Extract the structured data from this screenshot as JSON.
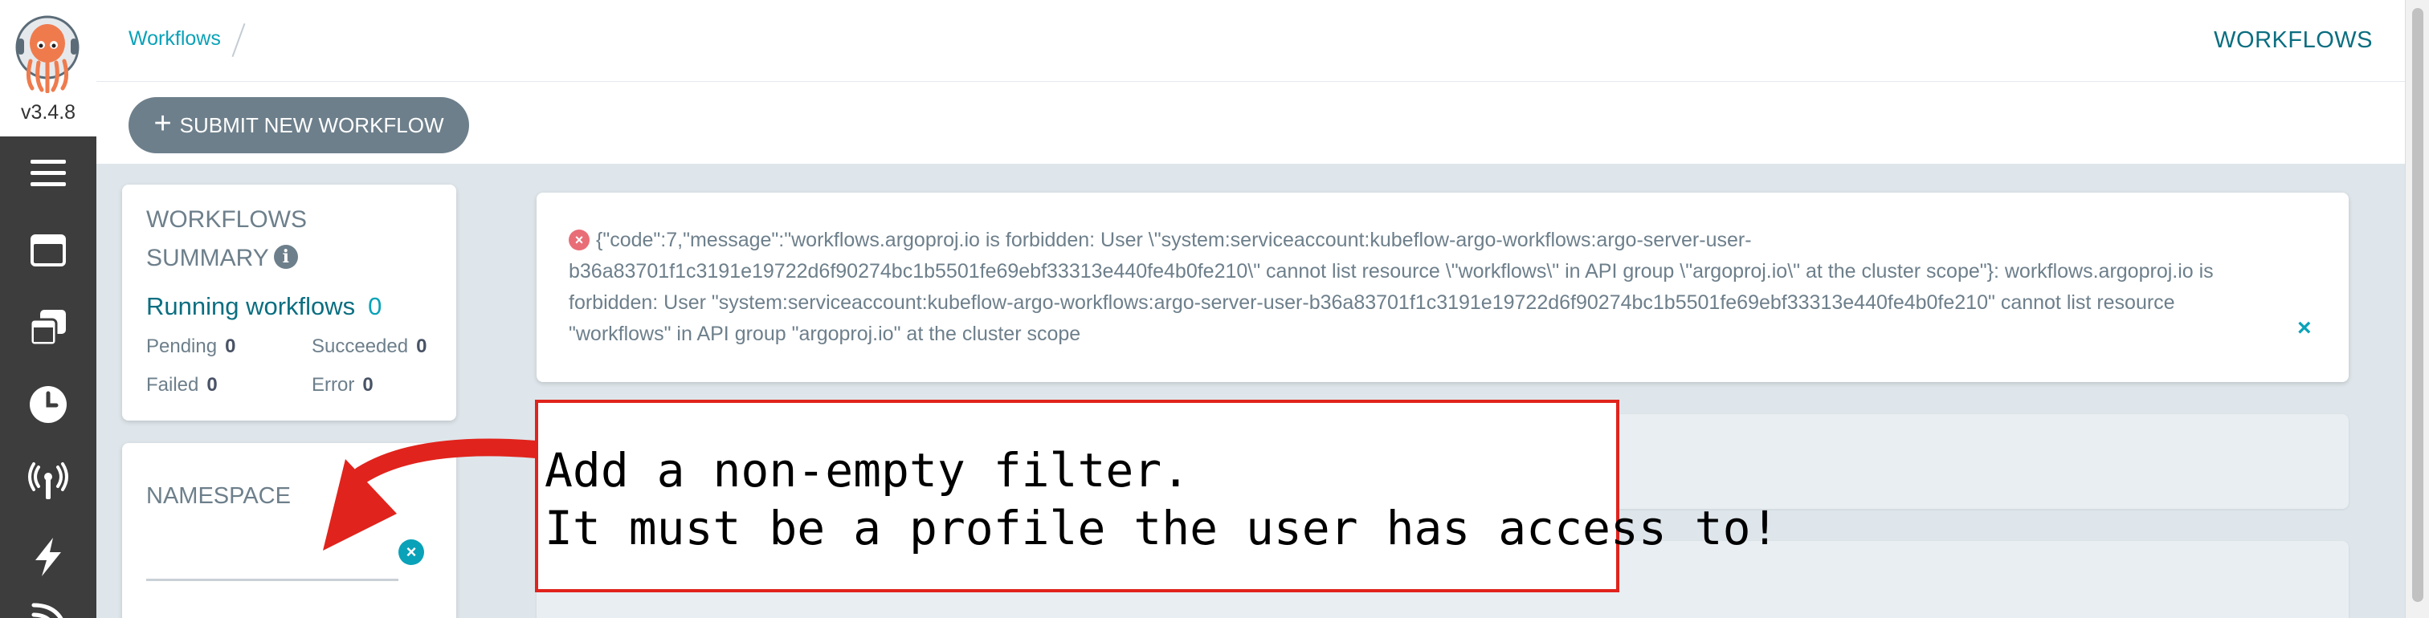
{
  "app": {
    "version": "v3.4.8"
  },
  "nav": {
    "items": [
      {
        "icon": "menu-icon"
      },
      {
        "icon": "workflows-icon"
      },
      {
        "icon": "workflow-templates-icon"
      },
      {
        "icon": "cron-workflows-icon"
      },
      {
        "icon": "event-sources-icon"
      },
      {
        "icon": "sensors-icon"
      },
      {
        "icon": "event-flow-icon"
      }
    ]
  },
  "header": {
    "breadcrumb": "Workflows",
    "title": "WORKFLOWS"
  },
  "toolbar": {
    "submit_label": "SUBMIT NEW WORKFLOW"
  },
  "summary": {
    "title": "WORKFLOWS SUMMARY",
    "running_label": "Running workflows",
    "running_count": "0",
    "pending_label": "Pending",
    "pending_count": "0",
    "succeeded_label": "Succeeded",
    "succeeded_count": "0",
    "failed_label": "Failed",
    "failed_count": "0",
    "error_label": "Error",
    "error_count": "0"
  },
  "namespace": {
    "label": "NAMESPACE",
    "value": ""
  },
  "error": {
    "message": "{\"code\":7,\"message\":\"workflows.argoproj.io is forbidden: User \\\"system:serviceaccount:kubeflow-argo-workflows:argo-server-user-b36a83701f1c3191e19722d6f90274bc1b5501fe69ebf33313e440fe4b0fe210\\\" cannot list resource \\\"workflows\\\" in API group \\\"argoproj.io\\\" at the cluster scope\"}: workflows.argoproj.io is forbidden: User \"system:serviceaccount:kubeflow-argo-workflows:argo-server-user-b36a83701f1c3191e19722d6f90274bc1b5501fe69ebf33313e440fe4b0fe210\" cannot list resource \"workflows\" in API group \"argoproj.io\" at the cluster scope"
  },
  "annotation": {
    "line1": "Add a non-empty filter.",
    "line2": "It must be a profile the user has access to!",
    "color": "#e0231c"
  },
  "colors": {
    "accent": "#0aa2b8",
    "nav_bg": "#3d3d3d",
    "button_bg": "#6d7f8b",
    "error": "#e96d76"
  }
}
